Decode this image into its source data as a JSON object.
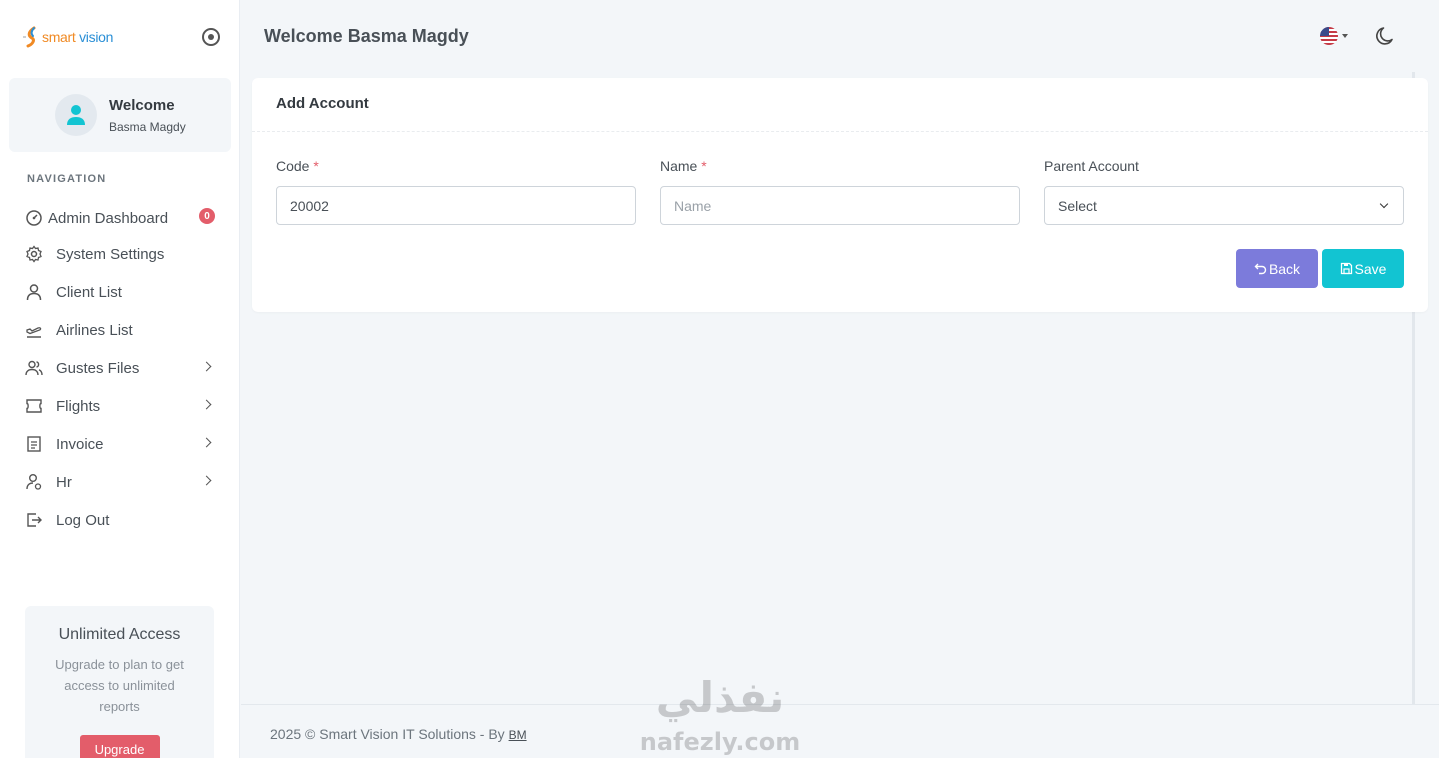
{
  "brand": {
    "text_part1": "smart",
    "text_part2": " vision"
  },
  "user": {
    "welcome": "Welcome",
    "name": "Basma Magdy"
  },
  "sidebar": {
    "caption": "NAVIGATION",
    "items": [
      {
        "label": "Admin Dashboard",
        "icon": "gauge-icon",
        "badge": "0"
      },
      {
        "label": "System Settings",
        "icon": "gear-icon"
      },
      {
        "label": "Client List",
        "icon": "user-icon"
      },
      {
        "label": "Airlines List",
        "icon": "plane-icon"
      },
      {
        "label": "Gustes Files",
        "icon": "users-icon",
        "has_submenu": true
      },
      {
        "label": "Flights",
        "icon": "ticket-icon",
        "has_submenu": true
      },
      {
        "label": "Invoice",
        "icon": "document-icon",
        "has_submenu": true
      },
      {
        "label": "Hr",
        "icon": "user-gear-icon",
        "has_submenu": true
      },
      {
        "label": "Log Out",
        "icon": "logout-icon"
      }
    ]
  },
  "promo": {
    "title": "Unlimited Access",
    "text": "Upgrade to plan to get access to unlimited reports",
    "button": "Upgrade"
  },
  "header": {
    "greeting": "Welcome Basma Magdy",
    "language_icon": "us-flag-icon",
    "theme_icon": "moon-icon"
  },
  "card": {
    "title": "Add Account",
    "fields": {
      "code": {
        "label": "Code",
        "required_mark": "*",
        "value": "20002"
      },
      "name": {
        "label": "Name",
        "required_mark": "*",
        "placeholder": "Name",
        "value": ""
      },
      "parent": {
        "label": "Parent Account",
        "selected": "Select"
      }
    },
    "buttons": {
      "back": "Back",
      "save": "Save"
    }
  },
  "footer": {
    "text": "2025 © Smart Vision IT Solutions - By ",
    "link": "BM"
  },
  "watermark": {
    "arabic": "نفذلي",
    "latin": "nafezly.com"
  },
  "colors": {
    "accent_cyan": "#12c4d2",
    "back_purple": "#7c7bdb",
    "badge_red": "#e35d6a",
    "page_bg": "#f3f6f9"
  }
}
